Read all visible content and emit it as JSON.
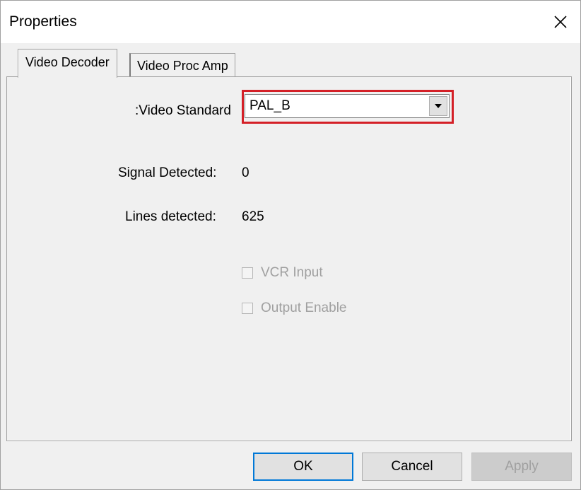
{
  "window": {
    "title": "Properties"
  },
  "tabs": [
    {
      "label": "Video Decoder",
      "selected": true
    },
    {
      "label": "Video Proc Amp",
      "selected": false
    }
  ],
  "decoder": {
    "video_standard_label": ":Video Standard",
    "video_standard_value": "PAL_B",
    "signal_detected_label": "Signal Detected:",
    "signal_detected_value": "0",
    "lines_detected_label": "Lines detected:",
    "lines_detected_value": "625",
    "vcr_input_label": "VCR Input",
    "output_enable_label": "Output Enable"
  },
  "buttons": {
    "ok": "OK",
    "cancel": "Cancel",
    "apply": "Apply"
  },
  "colors": {
    "highlight": "#d42027",
    "focus": "#0078d7"
  }
}
